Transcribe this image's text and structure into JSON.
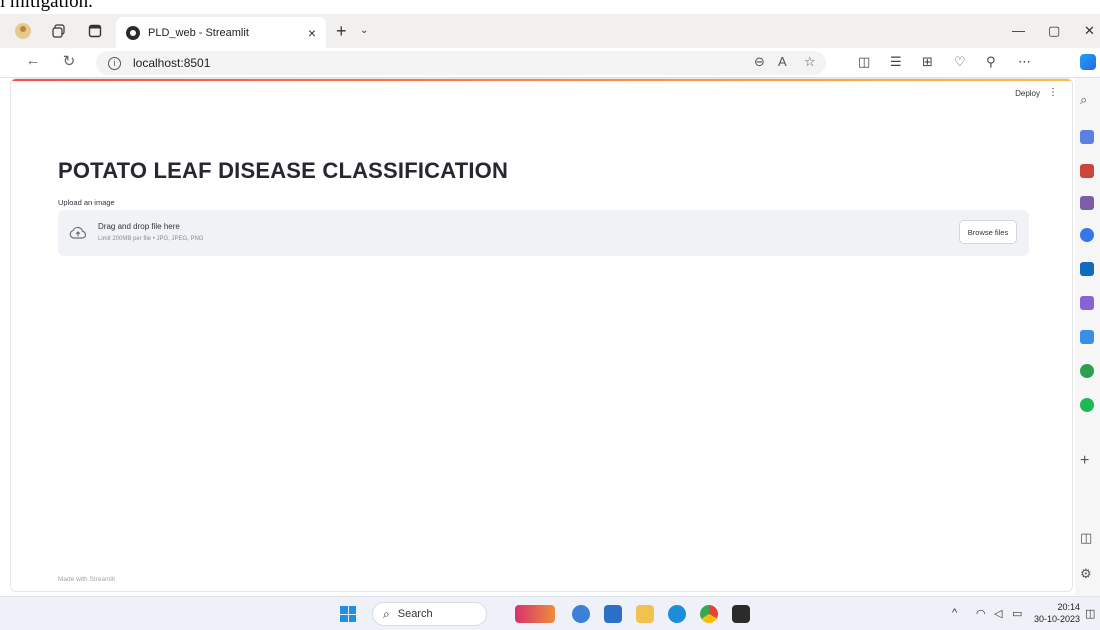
{
  "stray_text": "l mitigation.",
  "browser": {
    "tab_title": "PLD_web - Streamlit",
    "tab_close": "×",
    "new_tab": "+",
    "tab_menu": "⌄",
    "url": "localhost:8501",
    "window_minimize": "—",
    "window_maximize": "▢",
    "window_close": "✕"
  },
  "app": {
    "deploy_label": "Deploy",
    "menu_glyph": "⋮",
    "title": "POTATO LEAF DISEASE CLASSIFICATION",
    "upload_label": "Upload an image",
    "dropzone_title": "Drag and drop file here",
    "dropzone_limit": "Limit 200MB per file • JPG, JPEG, PNG",
    "browse_label": "Browse files",
    "footer_prefix": "Made with ",
    "footer_brand": "Streamlit"
  },
  "taskbar": {
    "search_placeholder": "Search",
    "time": "20:14",
    "date": "30-10-2023"
  },
  "colors": {
    "accent_start": "#ff4b4b",
    "accent_end": "#ffbd45",
    "dropzone_bg": "#f0f2f6",
    "title_color": "#262730"
  }
}
